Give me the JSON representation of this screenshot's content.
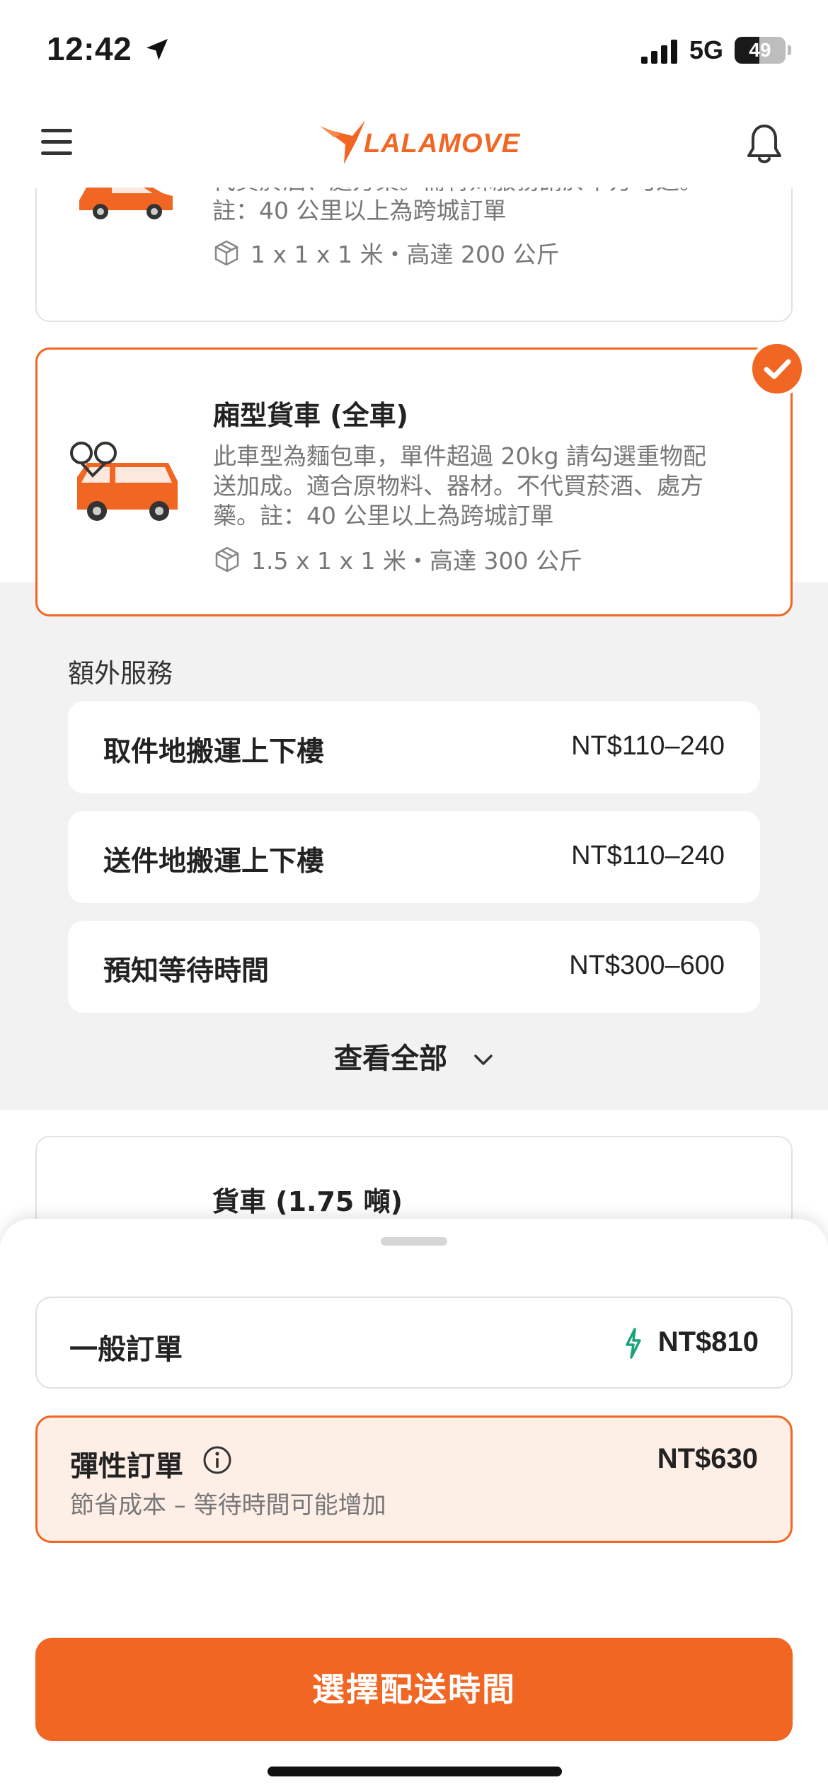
{
  "status_bar": {
    "time": "12:42",
    "network": "5G",
    "battery": "49",
    "battery_level": 0.49
  },
  "header": {
    "logo_text": "LALAMOVE"
  },
  "vehicles": [
    {
      "desc_lines": [
        "代買菸酒、處方藥。需特殊服務請於下方勾選。",
        "註：40 公里以上為跨城訂單"
      ],
      "spec": "1 x 1 x 1 米・高達 200 公斤"
    },
    {
      "title": "廂型貨車 (全車)",
      "desc_lines": [
        "此車型為麵包車，單件超過 20kg 請勾選重物配",
        "送加成。適合原物料、器材。不代買菸酒、處方",
        "藥。註：40 公里以上為跨城訂單"
      ],
      "spec": "1.5 x 1 x 1 米・高達 300 公斤",
      "selected": true
    },
    {
      "title": "貨車 (1.75 噸)"
    }
  ],
  "extras": {
    "title": "額外服務",
    "items": [
      {
        "label": "取件地搬運上下樓",
        "price": "NT$110–240"
      },
      {
        "label": "送件地搬運上下樓",
        "price": "NT$110–240"
      },
      {
        "label": "預知等待時間",
        "price": "NT$300–600"
      }
    ],
    "see_all": "查看全部"
  },
  "order_options": {
    "normal": {
      "label": "一般訂單",
      "price": "NT$810"
    },
    "flexible": {
      "label": "彈性訂單",
      "price": "NT$630",
      "subtitle": "節省成本 – 等待時間可能增加"
    }
  },
  "cta": {
    "label": "選擇配送時間"
  },
  "colors": {
    "accent": "#f16622",
    "flex_bg": "#fdeee6",
    "bolt": "#1aa37a",
    "extras_bg": "#f2f2f2"
  },
  "icons": [
    "location-arrow-icon",
    "signal-icon",
    "battery-icon",
    "menu-icon",
    "lalamove-logo",
    "bell-icon",
    "box-icon",
    "check-icon",
    "chevron-down-icon",
    "bolt-icon",
    "info-icon"
  ]
}
